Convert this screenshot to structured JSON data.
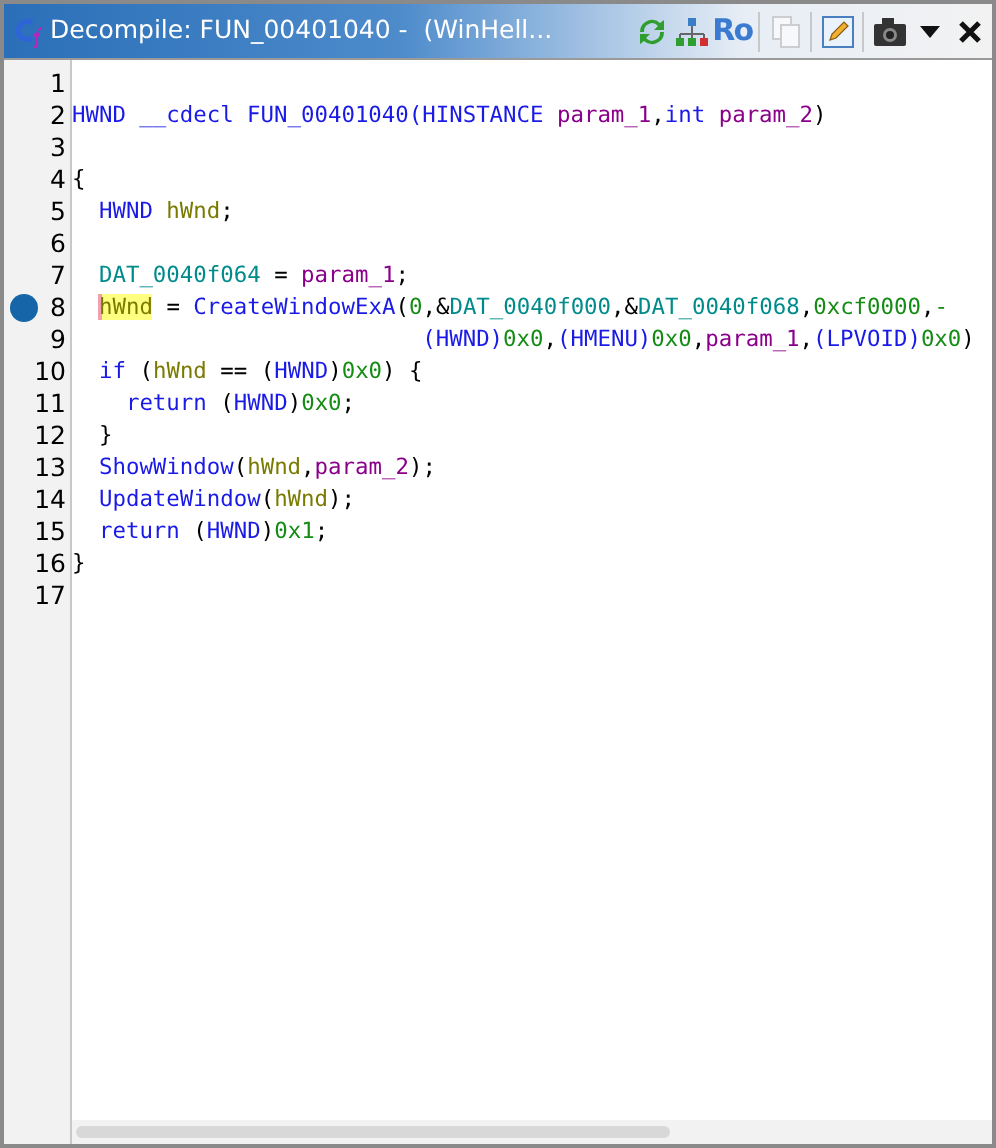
{
  "window": {
    "title": "Decompile: FUN_00401040 -  (WinHell...",
    "toolbar": [
      {
        "kind": "refresh"
      },
      {
        "kind": "graph"
      },
      {
        "kind": "text",
        "label": "Ro"
      },
      {
        "kind": "copy",
        "disabled": true
      },
      {
        "kind": "edit"
      },
      {
        "kind": "snapshot"
      },
      {
        "kind": "menu"
      },
      {
        "kind": "close"
      }
    ]
  },
  "lines": [
    {
      "number": "1",
      "breakpoint": false
    },
    {
      "number": "2",
      "breakpoint": false,
      "tokens": [
        {
          "text": "HWND __cdecl FUN_00401040(HINSTANCE ",
          "kind": "keyword"
        },
        {
          "text": "param_1",
          "kind": "param"
        },
        {
          "text": ",",
          "kind": "plain"
        },
        {
          "text": "int ",
          "kind": "keyword"
        },
        {
          "text": "param_2",
          "kind": "param"
        },
        {
          "text": ")",
          "kind": "plain"
        }
      ]
    },
    {
      "number": "3",
      "breakpoint": false
    },
    {
      "number": "4",
      "breakpoint": false,
      "tokens": [
        {
          "text": "{",
          "kind": "plain"
        }
      ]
    },
    {
      "number": "5",
      "breakpoint": false,
      "tokens": [
        {
          "text": "  HWND ",
          "kind": "keyword"
        },
        {
          "text": "hWnd",
          "kind": "variable"
        },
        {
          "text": ";",
          "kind": "plain"
        }
      ]
    },
    {
      "number": "6",
      "breakpoint": false
    },
    {
      "number": "7",
      "breakpoint": false,
      "tokens": [
        {
          "text": "  DAT_0040f064",
          "kind": "global"
        },
        {
          "text": " = ",
          "kind": "plain"
        },
        {
          "text": "param_1",
          "kind": "param"
        },
        {
          "text": ";",
          "kind": "plain"
        }
      ]
    },
    {
      "number": "8",
      "breakpoint": true,
      "tokens": [
        {
          "text": "  hWnd",
          "kind": "highlighted_variable"
        },
        {
          "text": " = ",
          "kind": "plain"
        },
        {
          "text": "CreateWindowExA",
          "kind": "keyword"
        },
        {
          "text": "(",
          "kind": "plain"
        },
        {
          "text": "0",
          "kind": "constant"
        },
        {
          "text": ",&",
          "kind": "plain"
        },
        {
          "text": "DAT_0040f000",
          "kind": "global"
        },
        {
          "text": ",&",
          "kind": "plain"
        },
        {
          "text": "DAT_0040f068",
          "kind": "global"
        },
        {
          "text": ",",
          "kind": "plain"
        },
        {
          "text": "0xcf0000",
          "kind": "constant"
        },
        {
          "text": ",",
          "kind": "plain"
        },
        {
          "text": "-",
          "kind": "constant"
        }
      ]
    },
    {
      "number": "9",
      "breakpoint": false,
      "tokens": [
        {
          "text": "                          (HWND)",
          "kind": "keyword"
        },
        {
          "text": "0x0",
          "kind": "constant"
        },
        {
          "text": ",",
          "kind": "plain"
        },
        {
          "text": "(HMENU)",
          "kind": "keyword"
        },
        {
          "text": "0x0",
          "kind": "constant"
        },
        {
          "text": ",",
          "kind": "plain"
        },
        {
          "text": "param_1",
          "kind": "param"
        },
        {
          "text": ",",
          "kind": "plain"
        },
        {
          "text": "(LPVOID)",
          "kind": "keyword"
        },
        {
          "text": "0x0",
          "kind": "constant"
        },
        {
          "text": ")",
          "kind": "plain"
        }
      ]
    },
    {
      "number": "10",
      "breakpoint": false,
      "tokens": [
        {
          "text": "  if",
          "kind": "keyword"
        },
        {
          "text": " (",
          "kind": "plain"
        },
        {
          "text": "hWnd",
          "kind": "variable"
        },
        {
          "text": " == (",
          "kind": "plain"
        },
        {
          "text": "HWND",
          "kind": "keyword"
        },
        {
          "text": ")",
          "kind": "plain"
        },
        {
          "text": "0x0",
          "kind": "constant"
        },
        {
          "text": ") {",
          "kind": "plain"
        }
      ]
    },
    {
      "number": "11",
      "breakpoint": false,
      "tokens": [
        {
          "text": "    return",
          "kind": "keyword"
        },
        {
          "text": " (",
          "kind": "plain"
        },
        {
          "text": "HWND",
          "kind": "keyword"
        },
        {
          "text": ")",
          "kind": "plain"
        },
        {
          "text": "0x0",
          "kind": "constant"
        },
        {
          "text": ";",
          "kind": "plain"
        }
      ]
    },
    {
      "number": "12",
      "breakpoint": false,
      "tokens": [
        {
          "text": "  }",
          "kind": "plain"
        }
      ]
    },
    {
      "number": "13",
      "breakpoint": false,
      "tokens": [
        {
          "text": "  ShowWindow",
          "kind": "keyword"
        },
        {
          "text": "(",
          "kind": "plain"
        },
        {
          "text": "hWnd",
          "kind": "variable"
        },
        {
          "text": ",",
          "kind": "plain"
        },
        {
          "text": "param_2",
          "kind": "param"
        },
        {
          "text": ");",
          "kind": "plain"
        }
      ]
    },
    {
      "number": "14",
      "breakpoint": false,
      "tokens": [
        {
          "text": "  UpdateWindow",
          "kind": "keyword"
        },
        {
          "text": "(",
          "kind": "plain"
        },
        {
          "text": "hWnd",
          "kind": "variable"
        },
        {
          "text": ");",
          "kind": "plain"
        }
      ]
    },
    {
      "number": "15",
      "breakpoint": false,
      "tokens": [
        {
          "text": "  return",
          "kind": "keyword"
        },
        {
          "text": " (",
          "kind": "plain"
        },
        {
          "text": "HWND",
          "kind": "keyword"
        },
        {
          "text": ")",
          "kind": "plain"
        },
        {
          "text": "0x1",
          "kind": "constant"
        },
        {
          "text": ";",
          "kind": "plain"
        }
      ]
    },
    {
      "number": "16",
      "breakpoint": false,
      "tokens": [
        {
          "text": "}",
          "kind": "plain"
        }
      ]
    },
    {
      "number": "17",
      "breakpoint": false
    }
  ]
}
